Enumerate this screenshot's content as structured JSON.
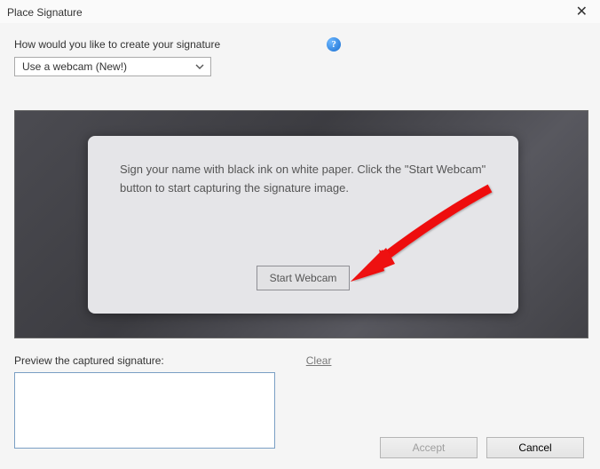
{
  "titlebar": {
    "title": "Place Signature",
    "close_glyph": "✕"
  },
  "prompt": {
    "label": "How would you like to create your signature",
    "help_glyph": "?"
  },
  "dropdown": {
    "selected": "Use a webcam (New!)"
  },
  "panel": {
    "instruction": "Sign your name with black ink on white paper. Click the \"Start Webcam\" button to start capturing the signature image.",
    "start_label": "Start Webcam"
  },
  "preview": {
    "label": "Preview the captured signature:",
    "clear_label": "Clear"
  },
  "footer": {
    "accept_label": "Accept",
    "cancel_label": "Cancel"
  }
}
